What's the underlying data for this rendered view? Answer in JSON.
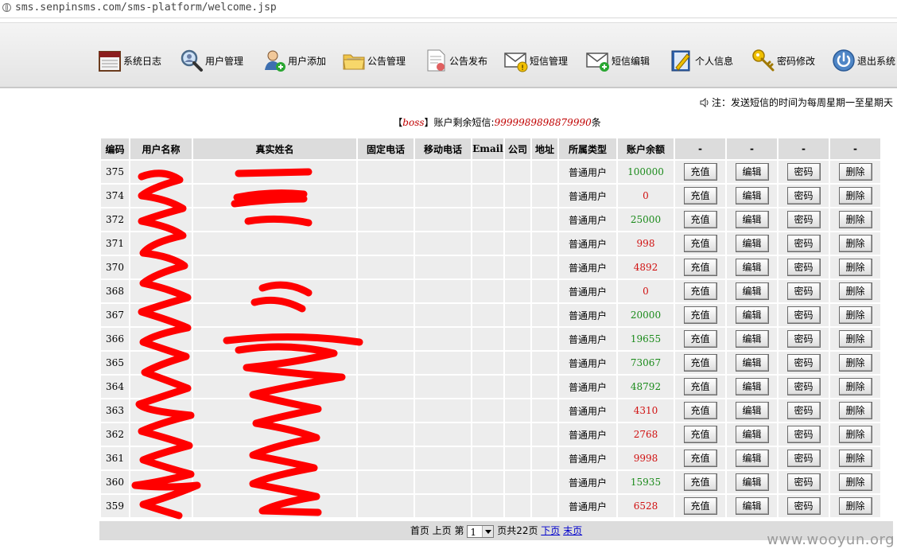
{
  "browser": {
    "url": "sms.senpinsms.com/sms-platform/welcome.jsp"
  },
  "nav": [
    {
      "label": "系统日志",
      "icon": "calendar-icon"
    },
    {
      "label": "用户管理",
      "icon": "magnifier-user-icon"
    },
    {
      "label": "用户添加",
      "icon": "user-add-icon"
    },
    {
      "label": "公告管理",
      "icon": "folder-icon"
    },
    {
      "label": "公告发布",
      "icon": "document-publish-icon"
    },
    {
      "label": "短信管理",
      "icon": "envelope-warning-icon"
    },
    {
      "label": "短信编辑",
      "icon": "envelope-edit-icon"
    },
    {
      "label": "个人信息",
      "icon": "notebook-pencil-icon"
    },
    {
      "label": "密码修改",
      "icon": "key-icon"
    },
    {
      "label": "退出系统",
      "icon": "power-icon"
    }
  ],
  "notice": "注：发送短信的时间为每周星期一至星期天",
  "balance": {
    "prefix": "【",
    "user": "boss",
    "mid": "】账户剩余短信:",
    "value": "9999989898879990",
    "suffix": "条"
  },
  "table": {
    "headers": [
      "编码",
      "用户名称",
      "真实姓名",
      "固定电话",
      "移动电话",
      "Email",
      "公司",
      "地址",
      "所属类型",
      "账户余额",
      "-",
      "-",
      "-",
      "-"
    ],
    "actions": [
      "充值",
      "编辑",
      "密码",
      "删除"
    ],
    "rows": [
      {
        "id": "375",
        "type": "普通用户",
        "balance": "100000",
        "status": "ok"
      },
      {
        "id": "374",
        "type": "普通用户",
        "balance": "0",
        "status": "low"
      },
      {
        "id": "372",
        "type": "普通用户",
        "balance": "25000",
        "status": "ok"
      },
      {
        "id": "371",
        "type": "普通用户",
        "balance": "998",
        "status": "low"
      },
      {
        "id": "370",
        "type": "普通用户",
        "balance": "4892",
        "status": "low"
      },
      {
        "id": "368",
        "type": "普通用户",
        "balance": "0",
        "status": "low"
      },
      {
        "id": "367",
        "type": "普通用户",
        "balance": "20000",
        "status": "ok"
      },
      {
        "id": "366",
        "type": "普通用户",
        "balance": "19655",
        "status": "ok"
      },
      {
        "id": "365",
        "type": "普通用户",
        "balance": "73067",
        "status": "ok"
      },
      {
        "id": "364",
        "type": "普通用户",
        "balance": "48792",
        "status": "ok"
      },
      {
        "id": "363",
        "type": "普通用户",
        "balance": "4310",
        "status": "low"
      },
      {
        "id": "362",
        "type": "普通用户",
        "balance": "2768",
        "status": "low"
      },
      {
        "id": "361",
        "type": "普通用户",
        "balance": "9998",
        "status": "low"
      },
      {
        "id": "360",
        "type": "普通用户",
        "balance": "15935",
        "status": "ok"
      },
      {
        "id": "359",
        "type": "普通用户",
        "balance": "6528",
        "status": "low"
      }
    ]
  },
  "pager": {
    "first": "首页",
    "prev": "上页",
    "page_prefix": "第",
    "current_page": "1",
    "page_suffix": "页共22页",
    "next": "下页",
    "last": "末页"
  },
  "colors": {
    "balance_ok": "#1a8a1a",
    "balance_low": "#d01010",
    "redaction": "#ff0000"
  },
  "watermark": "www.wooyun.org"
}
